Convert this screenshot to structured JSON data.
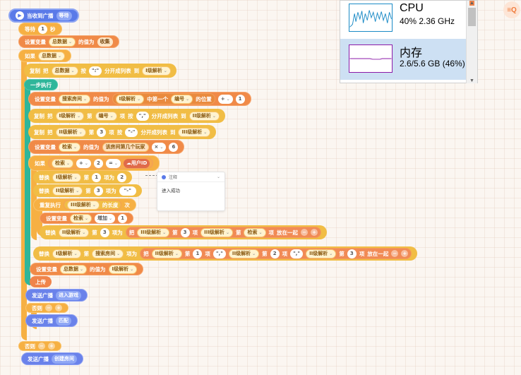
{
  "hat": {
    "label": "当收到广播",
    "msg": "等待"
  },
  "wait": {
    "label": "等待",
    "value": "1",
    "unit": "秒"
  },
  "set1": {
    "label": "设置变量",
    "var": "总数据",
    "mid": "的值为",
    "value": "收集"
  },
  "if1": {
    "label": "如果",
    "cond": "总数据"
  },
  "split1": {
    "label": "复制",
    "w1": "把",
    "src": "总数据",
    "w2": "按",
    "sep": "\":\"",
    "w3": "分开成列表",
    "w4": "到",
    "dst": "I级解析"
  },
  "step": {
    "label": "一步执行"
  },
  "set2": {
    "label": "设置变量",
    "var": "搜索房间",
    "mid": "的值为",
    "list": "I级解析",
    "w1": "中第一个",
    "item": "编号",
    "w2": "的位置",
    "op": "+",
    "n": "1"
  },
  "split2": {
    "label": "复制",
    "w1": "把",
    "list": "I级解析",
    "w2": "第",
    "idx": "编号",
    "w3": "项",
    "w4": "按",
    "sep": "\",\"",
    "w5": "分开成列表",
    "w6": "到",
    "dst": "II级解析"
  },
  "split3": {
    "label": "复制",
    "w1": "把",
    "list": "II级解析",
    "w2": "第",
    "idx": "3",
    "w3": "项",
    "w4": "按",
    "sep": "\"-\"",
    "w5": "分开成列表",
    "w6": "到",
    "dst": "III级解析"
  },
  "set3": {
    "label": "设置变量",
    "var": "检索",
    "mid": "的值为",
    "fn": "该房间第几个玩家",
    "op": "×",
    "n": "6"
  },
  "if2": {
    "label": "如果",
    "a": "检索",
    "op": "+",
    "n": "2",
    "eq": "=",
    "b": "用户ID"
  },
  "rep1": {
    "label": "替换",
    "list": "I级解析",
    "w1": "第",
    "idx": "1",
    "w2": "项为",
    "val": "2"
  },
  "rep2": {
    "label": "替换",
    "list": "II级解析",
    "w1": "第",
    "idx": "3",
    "w2": "项为",
    "val": "\"-\""
  },
  "loop": {
    "label": "重复执行",
    "list": "III级解析",
    "w1": "的长度",
    "w2": "次"
  },
  "inc": {
    "label": "设置变量",
    "var": "检索",
    "op": "增加",
    "n": "1"
  },
  "rep3": {
    "label": "替换",
    "list": "II级解析",
    "w1": "第",
    "idx": "3",
    "w2": "项为",
    "w3": "把",
    "l1": "III级解析",
    "w4": "第",
    "i1": "3",
    "w5": "项",
    "l2": "III级解析",
    "w6": "第",
    "i2": "检索",
    "w7": "项",
    "w8": "放在一起"
  },
  "rep4": {
    "label": "替换",
    "list": "I级解析",
    "w1": "第",
    "idx": "搜索房间",
    "w2": "项为",
    "w3": "把",
    "l1": "II级解析",
    "w4": "第",
    "i1": "1",
    "w5": "项",
    "s1": "\",\"",
    "l2": "II级解析",
    "w6": "第",
    "i2": "2",
    "w7": "项",
    "s2": "\",\"",
    "l3": "II级解析",
    "w8": "第",
    "i3": "3",
    "w9": "项",
    "w10": "放在一起"
  },
  "set4": {
    "label": "设置变量",
    "var": "总数据",
    "mid": "的值为",
    "value": "I级解析"
  },
  "upload": {
    "label": "上传"
  },
  "bc1": {
    "label": "发送广播",
    "msg": "进入游戏"
  },
  "else1": {
    "label": "否则"
  },
  "bc2": {
    "label": "发送广播",
    "msg": "匹配"
  },
  "else2": {
    "label": "否则"
  },
  "bc3": {
    "label": "发送广播",
    "msg": "创建房间"
  },
  "note": {
    "title": "注释",
    "text": "进入成功"
  },
  "perf": {
    "cpu_name": "CPU",
    "cpu_val": "40%  2.36 GHz",
    "mem_name": "内存",
    "mem_val": "2.6/5.6 GB (46%)"
  },
  "corner": {
    "label": "≡Q"
  }
}
